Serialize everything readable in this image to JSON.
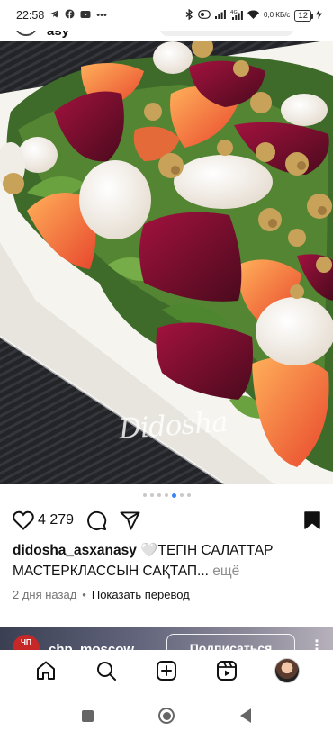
{
  "status_bar": {
    "time": "22:58",
    "left_icons": [
      "telegram-icon",
      "facebook-icon",
      "video-icon",
      "more-dots-icon"
    ],
    "right_icons": [
      "bluetooth-icon",
      "vpn-icon",
      "signal-icon",
      "4g-signal-icon",
      "wifi-icon"
    ],
    "network_speed": "0,0 КБ/с",
    "battery": "12"
  },
  "header": {
    "username_partial": "asy"
  },
  "post": {
    "watermark": "Didosha",
    "carousel": {
      "total": 7,
      "active": 4
    },
    "likes_count": "4 279",
    "caption": {
      "username": "didosha_asxanasy",
      "text": "🤍ТЕГІН САЛАТТАР МАСТЕРКЛАССЫН САҚТАП...",
      "more_label": "ещё"
    },
    "time_ago": "2 дня назад",
    "separator": "•",
    "translate_label": "Показать перевод"
  },
  "next_post": {
    "avatar_text": "ЧП",
    "username": "chp_moscow",
    "follow_label": "Подписаться",
    "more_label": "⋮"
  },
  "colors": {
    "accent": "#3b82f6",
    "text": "#111111",
    "muted": "#737373"
  }
}
